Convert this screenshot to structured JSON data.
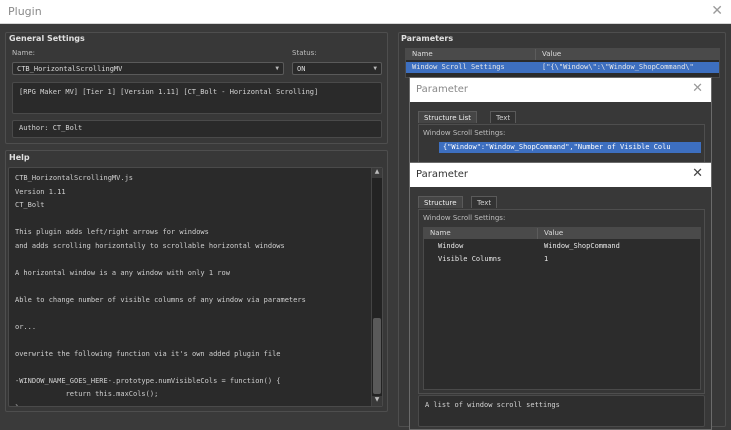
{
  "window": {
    "title": "Plugin"
  },
  "general": {
    "title": "General Settings",
    "name_label": "Name:",
    "name_value": "CTB_HorizontalScrollingMV",
    "status_label": "Status:",
    "status_value": "ON",
    "description": "[RPG Maker MV] [Tier 1] [Version 1.11] [CT_Bolt - Horizontal Scrolling]",
    "author": "Author: CT_Bolt"
  },
  "help": {
    "title": "Help",
    "lines": [
      "CTB_HorizontalScrollingMV.js",
      "Version 1.11",
      "CT_Bolt",
      "",
      "This plugin adds left/right arrows for windows",
      "and adds scrolling horizontally to scrollable horizontal windows",
      "",
      "A horizontal window is a any window with only 1 row",
      "",
      "Able to change number of visible columns of any window via parameters",
      "",
      "or...",
      "",
      "overwrite the following function via it's own added plugin file",
      "",
      "-WINDOW_NAME_GOES_HERE-.prototype.numVisibleCols = function() {",
      "            return this.maxCols();",
      "};"
    ]
  },
  "parameters": {
    "title": "Parameters",
    "col_name": "Name",
    "col_value": "Value",
    "rows": [
      {
        "name": "Window Scroll Settings",
        "value": "[\"{\\\"Window\\\":\\\"Window_ShopCommand\\\""
      }
    ]
  },
  "dialog1": {
    "title": "Parameter",
    "tabs": [
      "Structure List",
      "Text"
    ],
    "list_label": "Window Scroll Settings:",
    "item": "{\"Window\":\"Window_ShopCommand\",\"Number of Visible Colu"
  },
  "dialog2": {
    "title": "Parameter",
    "tabs": [
      "Structure",
      "Text"
    ],
    "table_label": "Window Scroll Settings:",
    "col_name": "Name",
    "col_value": "Value",
    "rows": [
      {
        "name": "Window",
        "value": "Window_ShopCommand"
      },
      {
        "name": "Visible Columns",
        "value": "1"
      }
    ],
    "description": "A list of window scroll settings"
  },
  "colors": {
    "selection": "#3d6fc0",
    "background": "#3a3a3a"
  }
}
